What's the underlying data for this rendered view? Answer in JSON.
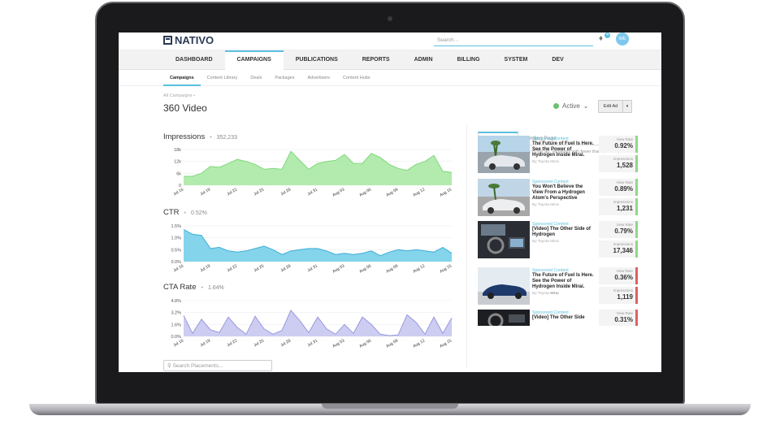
{
  "app": {
    "logo_text": "NATIVO",
    "search_placeholder": "Search...",
    "notification_count": "4",
    "avatar_initials": "WE"
  },
  "main_nav": [
    "DASHBOARD",
    "CAMPAIGNS",
    "PUBLICATIONS",
    "REPORTS",
    "ADMIN",
    "BILLING",
    "SYSTEM",
    "DEV"
  ],
  "main_nav_active": "CAMPAIGNS",
  "sub_nav": [
    "Campaigns",
    "Content Library",
    "Deals",
    "Packages",
    "Advertisers",
    "Content Hubs"
  ],
  "page": {
    "breadcrumb": "All Campaigns •",
    "title": "360 Video",
    "status": "Active",
    "status_caret": "⌄",
    "edit_label": "Edit Ad",
    "edit_caret": "▾"
  },
  "colors": {
    "accent": "#5bc0de",
    "impressions": "#a6e8a0",
    "ctr": "#6fcde8",
    "cta": "#c4c4f0",
    "active": "#6cc070"
  },
  "x_ticks": [
    "Jul 16",
    "Jul 19",
    "Jul 22",
    "Jul 25",
    "Jul 28",
    "Jul 31",
    "Aug 03",
    "Aug 06",
    "Aug 09",
    "Aug 12",
    "Aug 15"
  ],
  "chart_data": [
    {
      "type": "area",
      "title": "Impressions",
      "summary": "352,233",
      "x": [
        "Jul 16",
        "Jul 17",
        "Jul 18",
        "Jul 19",
        "Jul 20",
        "Jul 21",
        "Jul 22",
        "Jul 23",
        "Jul 24",
        "Jul 25",
        "Jul 26",
        "Jul 27",
        "Jul 28",
        "Jul 29",
        "Jul 30",
        "Jul 31",
        "Aug 01",
        "Aug 02",
        "Aug 03",
        "Aug 04",
        "Aug 05",
        "Aug 06",
        "Aug 07",
        "Aug 08",
        "Aug 09",
        "Aug 10",
        "Aug 11",
        "Aug 12",
        "Aug 13",
        "Aug 14",
        "Aug 15"
      ],
      "values": [
        4500,
        4500,
        6000,
        9500,
        9000,
        11000,
        13000,
        12000,
        10500,
        8000,
        8500,
        8000,
        17000,
        12500,
        8000,
        11000,
        12000,
        12500,
        15500,
        11000,
        11000,
        16000,
        14000,
        10500,
        8500,
        7500,
        10500,
        12000,
        15000,
        7000,
        6500
      ],
      "y_ticks": [
        "18k",
        "12k",
        "6k",
        "0"
      ],
      "ylim": [
        0,
        18000
      ]
    },
    {
      "type": "area",
      "title": "CTR",
      "summary": "0.52%",
      "x": [
        "Jul 16",
        "Jul 17",
        "Jul 18",
        "Jul 19",
        "Jul 20",
        "Jul 21",
        "Jul 22",
        "Jul 23",
        "Jul 24",
        "Jul 25",
        "Jul 26",
        "Jul 27",
        "Jul 28",
        "Jul 29",
        "Jul 30",
        "Jul 31",
        "Aug 01",
        "Aug 02",
        "Aug 03",
        "Aug 04",
        "Aug 05",
        "Aug 06",
        "Aug 07",
        "Aug 08",
        "Aug 09",
        "Aug 10",
        "Aug 11",
        "Aug 12",
        "Aug 13",
        "Aug 14",
        "Aug 15"
      ],
      "values": [
        1.35,
        1.15,
        1.1,
        0.55,
        0.6,
        0.45,
        0.4,
        0.45,
        0.55,
        0.65,
        0.5,
        0.3,
        0.45,
        0.5,
        0.55,
        0.55,
        0.45,
        0.3,
        0.35,
        0.3,
        0.35,
        0.45,
        0.25,
        0.4,
        0.5,
        0.45,
        0.5,
        0.45,
        0.4,
        0.6,
        0.35
      ],
      "y_ticks": [
        "1.5%",
        "1.0%",
        "0.5%",
        "0.0%"
      ],
      "ylim": [
        0,
        1.5
      ]
    },
    {
      "type": "area",
      "title": "CTA Rate",
      "summary": "1.64%",
      "x": [
        "Jul 16",
        "Jul 17",
        "Jul 18",
        "Jul 19",
        "Jul 20",
        "Jul 21",
        "Jul 22",
        "Jul 23",
        "Jul 24",
        "Jul 25",
        "Jul 26",
        "Jul 27",
        "Jul 28",
        "Jul 29",
        "Jul 30",
        "Jul 31",
        "Aug 01",
        "Aug 02",
        "Aug 03",
        "Aug 04",
        "Aug 05",
        "Aug 06",
        "Aug 07",
        "Aug 08",
        "Aug 09",
        "Aug 10",
        "Aug 11",
        "Aug 12",
        "Aug 13",
        "Aug 14",
        "Aug 15"
      ],
      "values": [
        2.8,
        0.4,
        2.3,
        0.9,
        0.5,
        2.6,
        1.2,
        0.3,
        2.7,
        1.0,
        0.3,
        0.8,
        3.5,
        2.1,
        0.5,
        2.6,
        1.0,
        0.3,
        1.6,
        0.4,
        2.6,
        1.6,
        0.3,
        0.1,
        0.2,
        2.9,
        1.9,
        0.3,
        2.6,
        0.4,
        2.5
      ],
      "y_ticks": [
        "4.8%",
        "3.2%",
        "1.6%",
        "0.0%"
      ],
      "ylim": [
        0,
        4.8
      ]
    }
  ],
  "placements_search_placeholder": "Search Placements...",
  "right_panel": {
    "tabs": [
      "In-feed Unit",
      "Landing Page"
    ],
    "note": "Showing 10 of 54 variations of this ad. Variations with fewer than 1,000 impressions are not shown.",
    "view_rate_label": "View Rate",
    "impressions_label": "Impressions",
    "more": "•••",
    "ads": [
      {
        "sponsor": "Sponsored Content",
        "headline": "The Future of Fuel Is Here. See the Power of Hydrogen Inside Mirai.",
        "by": "By Toyota Mirai",
        "view_rate": "0.92%",
        "impressions": "1,528",
        "bar": "#8fd88c"
      },
      {
        "sponsor": "Sponsored Content",
        "headline": "You Won't Believe the View From a Hydrogen Atom's Perspective",
        "by": "By Toyota Mirai",
        "view_rate": "0.89%",
        "impressions": "1,231",
        "bar": "#8fd88c"
      },
      {
        "sponsor": "Sponsored Content",
        "headline": "[Video] The Other Side of Hydrogen",
        "by": "By Toyota Mirai",
        "view_rate": "0.79%",
        "impressions": "17,346",
        "bar": "#8fd88c"
      },
      {
        "sponsor": "Sponsored Content",
        "headline": "The Future of Fuel Is Here. See the Power of Hydrogen Inside Mirai.",
        "by": "By Toyota Mirai",
        "view_rate": "0.36%",
        "impressions": "1,119",
        "bar": "#e06060"
      },
      {
        "sponsor": "Sponsored Content",
        "headline": "[Video] The Other Side",
        "by": "",
        "view_rate": "0.31%",
        "impressions": "",
        "bar": "#e06060"
      }
    ]
  }
}
